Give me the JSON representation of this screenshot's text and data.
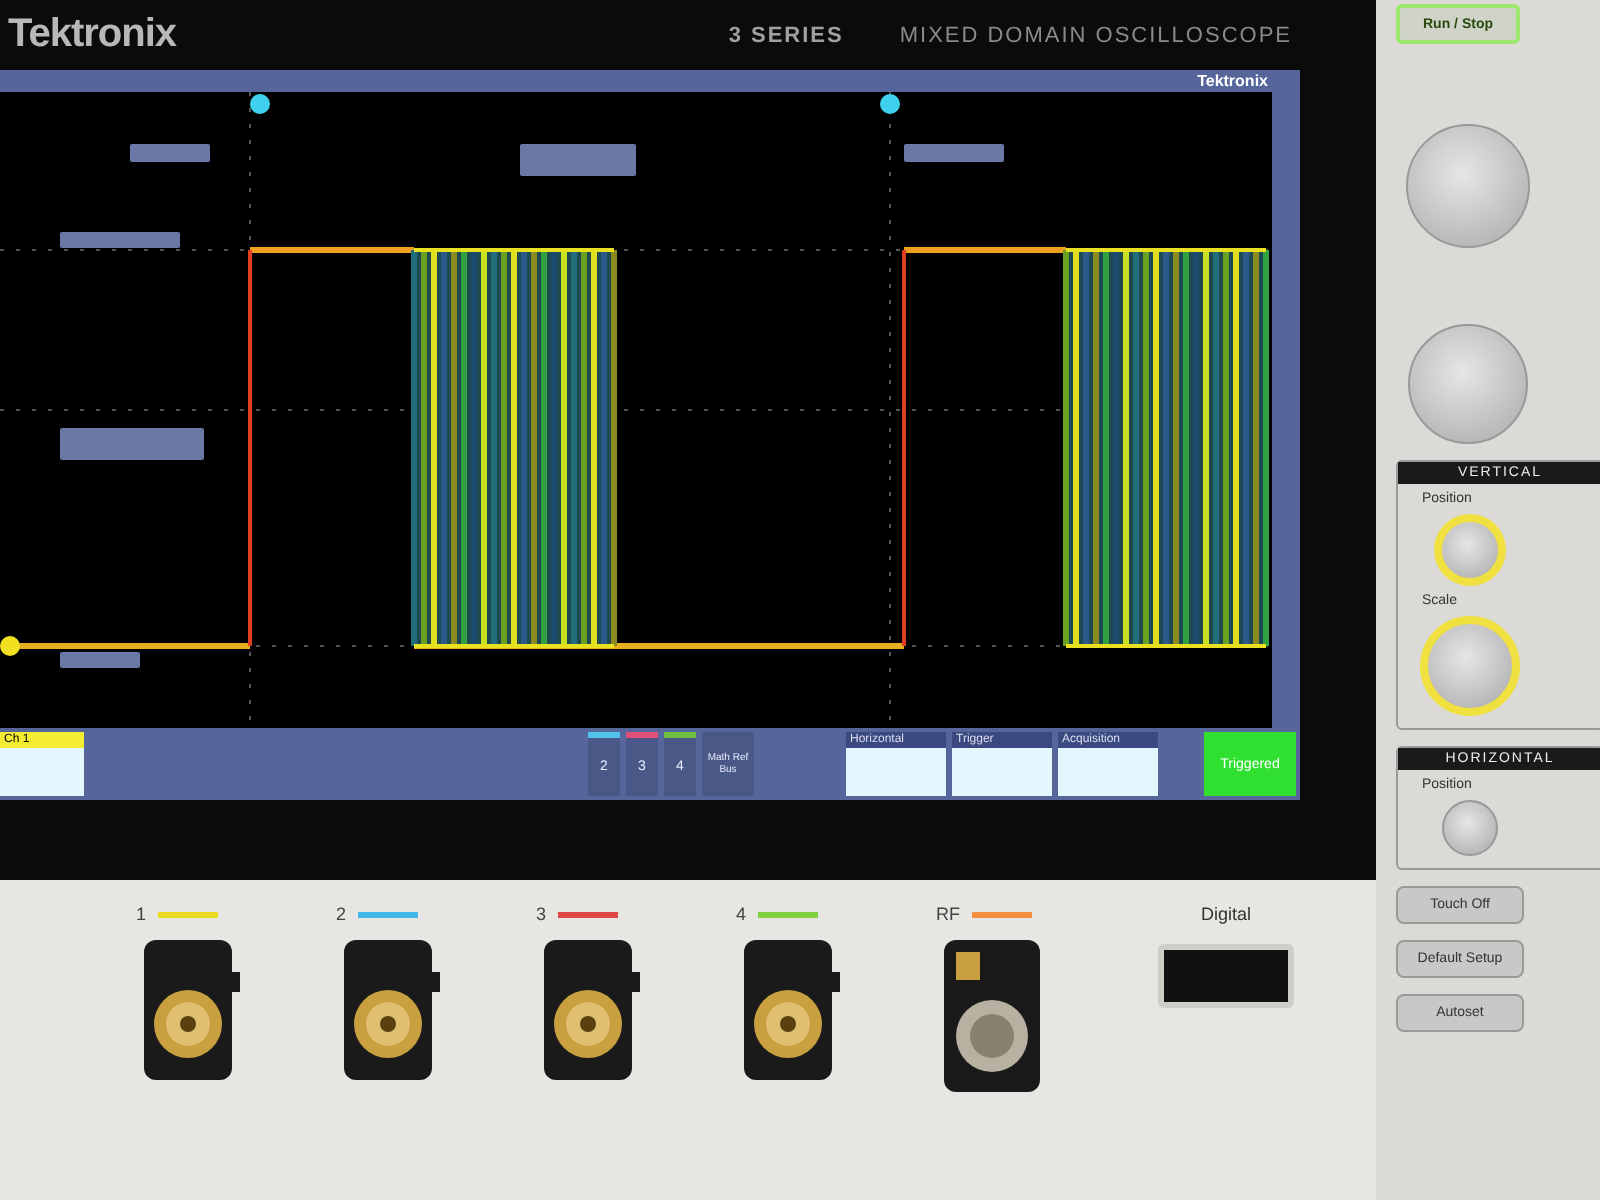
{
  "brand": {
    "logo": "Tektronix",
    "series": "3 SERIES",
    "model": "MIXED DOMAIN OSCILLOSCOPE"
  },
  "display": {
    "logo": "Tektronix",
    "channel": "Ch 1",
    "channel_buttons": [
      {
        "label": "2",
        "color": "#4fc3e8"
      },
      {
        "label": "3",
        "color": "#e0507a"
      },
      {
        "label": "4",
        "color": "#6ec040"
      }
    ],
    "math_button": "Math Ref Bus",
    "panels": [
      {
        "title": "Horizontal"
      },
      {
        "title": "Trigger"
      },
      {
        "title": "Acquisition"
      }
    ],
    "status": "Triggered"
  },
  "controls": {
    "run_stop": "Run / Stop",
    "vertical": {
      "title": "VERTICAL",
      "position": "Position",
      "scale": "Scale"
    },
    "horizontal": {
      "title": "HORIZONTAL",
      "position": "Position"
    },
    "buttons": [
      "Touch Off",
      "Default Setup",
      "Autoset"
    ]
  },
  "inputs": [
    {
      "label": "1",
      "color": "#e8d820",
      "kind": "bnc"
    },
    {
      "label": "2",
      "color": "#40b8e8",
      "kind": "bnc"
    },
    {
      "label": "3",
      "color": "#e04848",
      "kind": "bnc"
    },
    {
      "label": "4",
      "color": "#80d040",
      "kind": "bnc"
    },
    {
      "label": "RF",
      "color": "#f09040",
      "kind": "rf"
    }
  ],
  "digital": {
    "label": "Digital"
  }
}
